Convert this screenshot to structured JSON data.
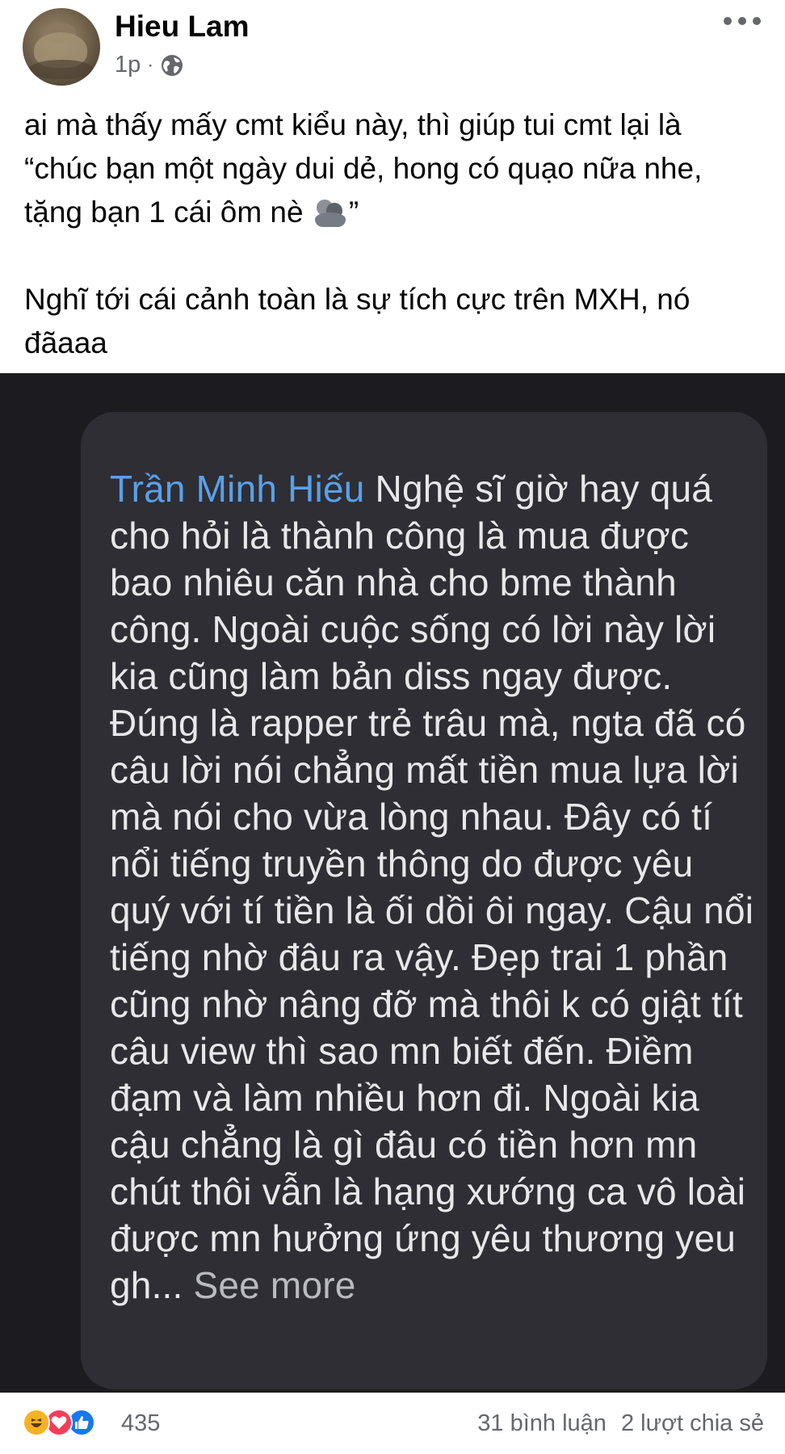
{
  "post": {
    "author": "Hieu Lam",
    "time": "1p",
    "separator": "·",
    "text_line1": "ai mà thấy mấy cmt kiểu này, thì giúp tui cmt lại là",
    "text_line2": "“chúc bạn một ngày dui dẻ, hong có quạo nữa nhe,",
    "text_line3_before": "tặng bạn 1 cái ôm nè ",
    "text_line3_after": "”",
    "text_line4": "Nghĩ tới cái cảnh toàn là sự tích cực trên MXH, nó",
    "text_line5": "đãaaa"
  },
  "comment": {
    "commenter": "Trần Minh Hiếu",
    "body": " Nghệ sĩ giờ hay quá cho hỏi là thành công là mua được bao nhiêu căn nhà cho bme thành công. Ngoài cuộc sống có lời này lời kia cũng làm bản diss ngay được. Đúng là rapper trẻ trâu mà, ngta đã có câu lời nói chẳng mất tiền mua lựa lời mà nói cho vừa lòng nhau. Đây có tí nổi tiếng truyền thông do được yêu quý với tí tiền là ối dồi ôi ngay. Cậu nổi tiếng nhờ đâu ra vậy. Đẹp trai 1 phần cũng nhờ nâng đỡ mà thôi k có giật tít câu view thì sao mn biết đến. Điềm đạm và làm nhiều hơn đi. Ngoài kia cậu chẳng là gì đâu có tiền hơn mn chút thôi vẫn là hạng xướng ca vô loài được mn hưởng ứng yêu thương yeu gh... ",
    "see_more": "See more"
  },
  "footer": {
    "reaction_count": "435",
    "comments": "31 bình luận",
    "shares": "2 lượt chia sẻ"
  },
  "icons": {
    "globe": "globe-icon",
    "more": "more-options-icon",
    "hug": "hug-emoji-icon",
    "haha": "haha-reaction-icon",
    "love": "love-reaction-icon",
    "like": "like-reaction-icon"
  },
  "colors": {
    "commenter_name": "#5aa0ea",
    "dark_background": "#1c1c20",
    "bubble": "#2e2e34",
    "like_blue": "#1877f2",
    "love_red": "#f33e58",
    "haha_yellow": "#f7b125"
  }
}
